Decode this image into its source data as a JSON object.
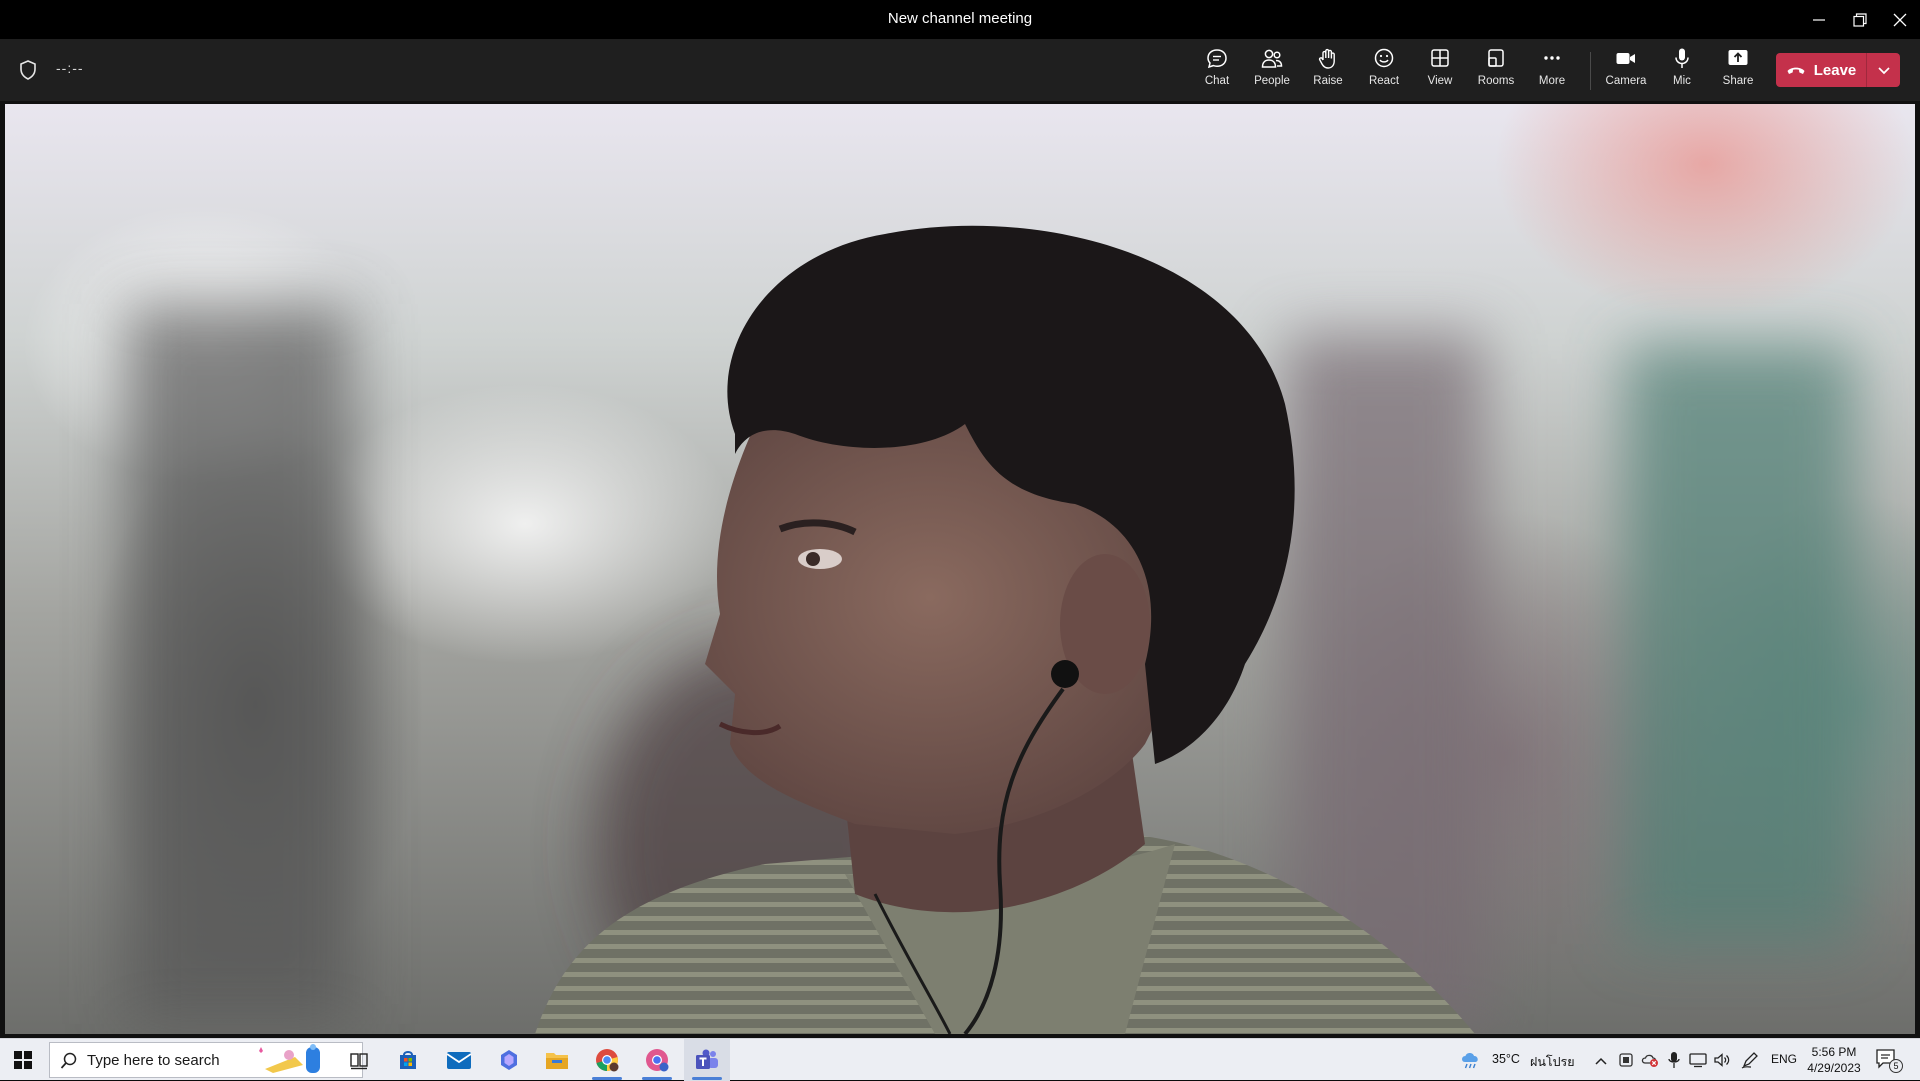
{
  "window": {
    "title": "New channel meeting"
  },
  "meeting": {
    "timer": "--:--",
    "buttons": {
      "chat": "Chat",
      "people": "People",
      "raise": "Raise",
      "react": "React",
      "view": "View",
      "rooms": "Rooms",
      "more": "More",
      "camera": "Camera",
      "mic": "Mic",
      "share": "Share"
    },
    "leave_label": "Leave"
  },
  "taskbar": {
    "search_placeholder": "Type here to search",
    "weather_temp": "35°C",
    "weather_desc": "ฝนโปรย",
    "language": "ENG",
    "time": "5:56 PM",
    "date": "4/29/2023",
    "notifications_count": "5"
  },
  "colors": {
    "leave_red": "#c4314b",
    "toolbar_bg": "#1f1f1f",
    "taskbar_bg": "#eceef3"
  }
}
